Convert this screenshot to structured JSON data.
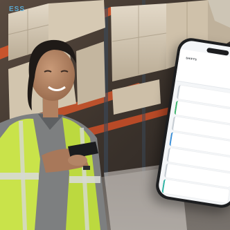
{
  "brand": {
    "fragment": "ESS"
  },
  "phone": {
    "app_title": "SHIFTS",
    "days": [
      "",
      "",
      "",
      "",
      "",
      "",
      ""
    ],
    "tasks": [
      {
        "name": "",
        "time": ""
      },
      {
        "name": "",
        "time": ""
      },
      {
        "name": "",
        "time": ""
      },
      {
        "name": "",
        "time": ""
      },
      {
        "name": "",
        "time": ""
      },
      {
        "name": "",
        "time": ""
      },
      {
        "name": "",
        "time": ""
      }
    ]
  },
  "colors": {
    "accent_green": "#39b36a",
    "accent_blue": "#3a8fd8",
    "vest_yellow": "#c9e34a",
    "shelf_orange": "#d8643a"
  }
}
